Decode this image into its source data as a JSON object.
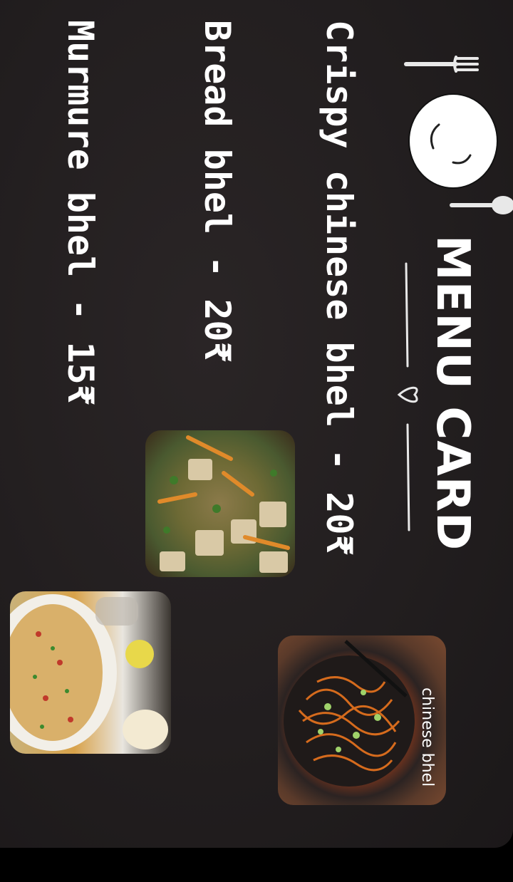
{
  "menu": {
    "title": "MENU CARD",
    "items": [
      {
        "label": "Crispy chinese bhel - 20₹"
      },
      {
        "label": "Bread bhel - 20₹"
      },
      {
        "label": "Murmure bhel -   15₹"
      }
    ]
  },
  "photos": {
    "noodles_caption": "chinese bhel"
  },
  "colors": {
    "background": "#221e1f",
    "text": "#ffffff"
  },
  "icons": [
    "plate-icon",
    "fork-icon",
    "spoon-icon",
    "heart-icon",
    "divider-line"
  ]
}
